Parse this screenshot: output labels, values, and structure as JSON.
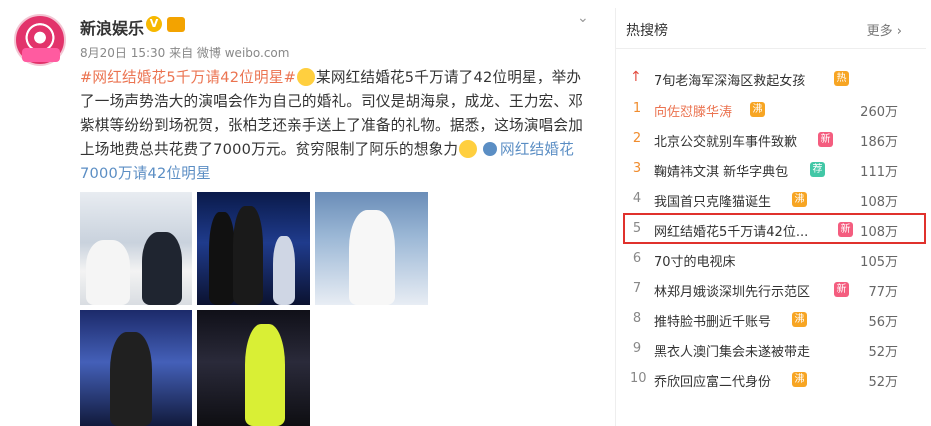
{
  "post": {
    "author": "新浪娱乐",
    "meta": "8月20日 15:30 来自 微博 weibo.com",
    "topic": "#网红结婚花5千万请42位明星#",
    "text_line": "某网红结婚花5千万请了42位明星，举办了一场声势浩大的演唱会作为自己的婚礼。司仪是胡海泉，成龙、王力宏、邓紫棋等纷纷到场祝贺，张柏芝还亲手送上了准备的礼物。据悉，这场演唱会加上场地费总共花费了7000万元。贫穷限制了阿乐的想象力",
    "link_text": "网红结婚花7000万请42位明星"
  },
  "panel": {
    "title": "热搜榜",
    "more": "更多 ›",
    "items": [
      {
        "rank": "↑",
        "title": "7旬老海军深海区救起女孩",
        "tag": "热",
        "tag_type": "hot",
        "count": ""
      },
      {
        "rank": "1",
        "title": "向佐怼滕华涛",
        "tag": "沸",
        "tag_type": "hot",
        "count": "260万"
      },
      {
        "rank": "2",
        "title": "北京公交就别车事件致歉",
        "tag": "新",
        "tag_type": "new",
        "count": "186万"
      },
      {
        "rank": "3",
        "title": "鞠婧祎文淇 新华字典包",
        "tag": "荐",
        "tag_type": "rec",
        "count": "111万"
      },
      {
        "rank": "4",
        "title": "我国首只克隆猫诞生",
        "tag": "沸",
        "tag_type": "hot",
        "count": "108万"
      },
      {
        "rank": "5",
        "title": "网红结婚花5千万请42位...",
        "tag": "新",
        "tag_type": "new",
        "count": "108万"
      },
      {
        "rank": "6",
        "title": "70寸的电视床",
        "tag": "",
        "tag_type": "",
        "count": "105万"
      },
      {
        "rank": "7",
        "title": "林郑月娥谈深圳先行示范区",
        "tag": "新",
        "tag_type": "new",
        "count": "77万"
      },
      {
        "rank": "8",
        "title": "推特脸书删近千账号",
        "tag": "沸",
        "tag_type": "hot",
        "count": "56万"
      },
      {
        "rank": "9",
        "title": "黑衣人澳门集会未遂被带走",
        "tag": "",
        "tag_type": "",
        "count": "52万"
      },
      {
        "rank": "10",
        "title": "乔欣回应富二代身份",
        "tag": "沸",
        "tag_type": "hot",
        "count": "52万"
      }
    ]
  }
}
